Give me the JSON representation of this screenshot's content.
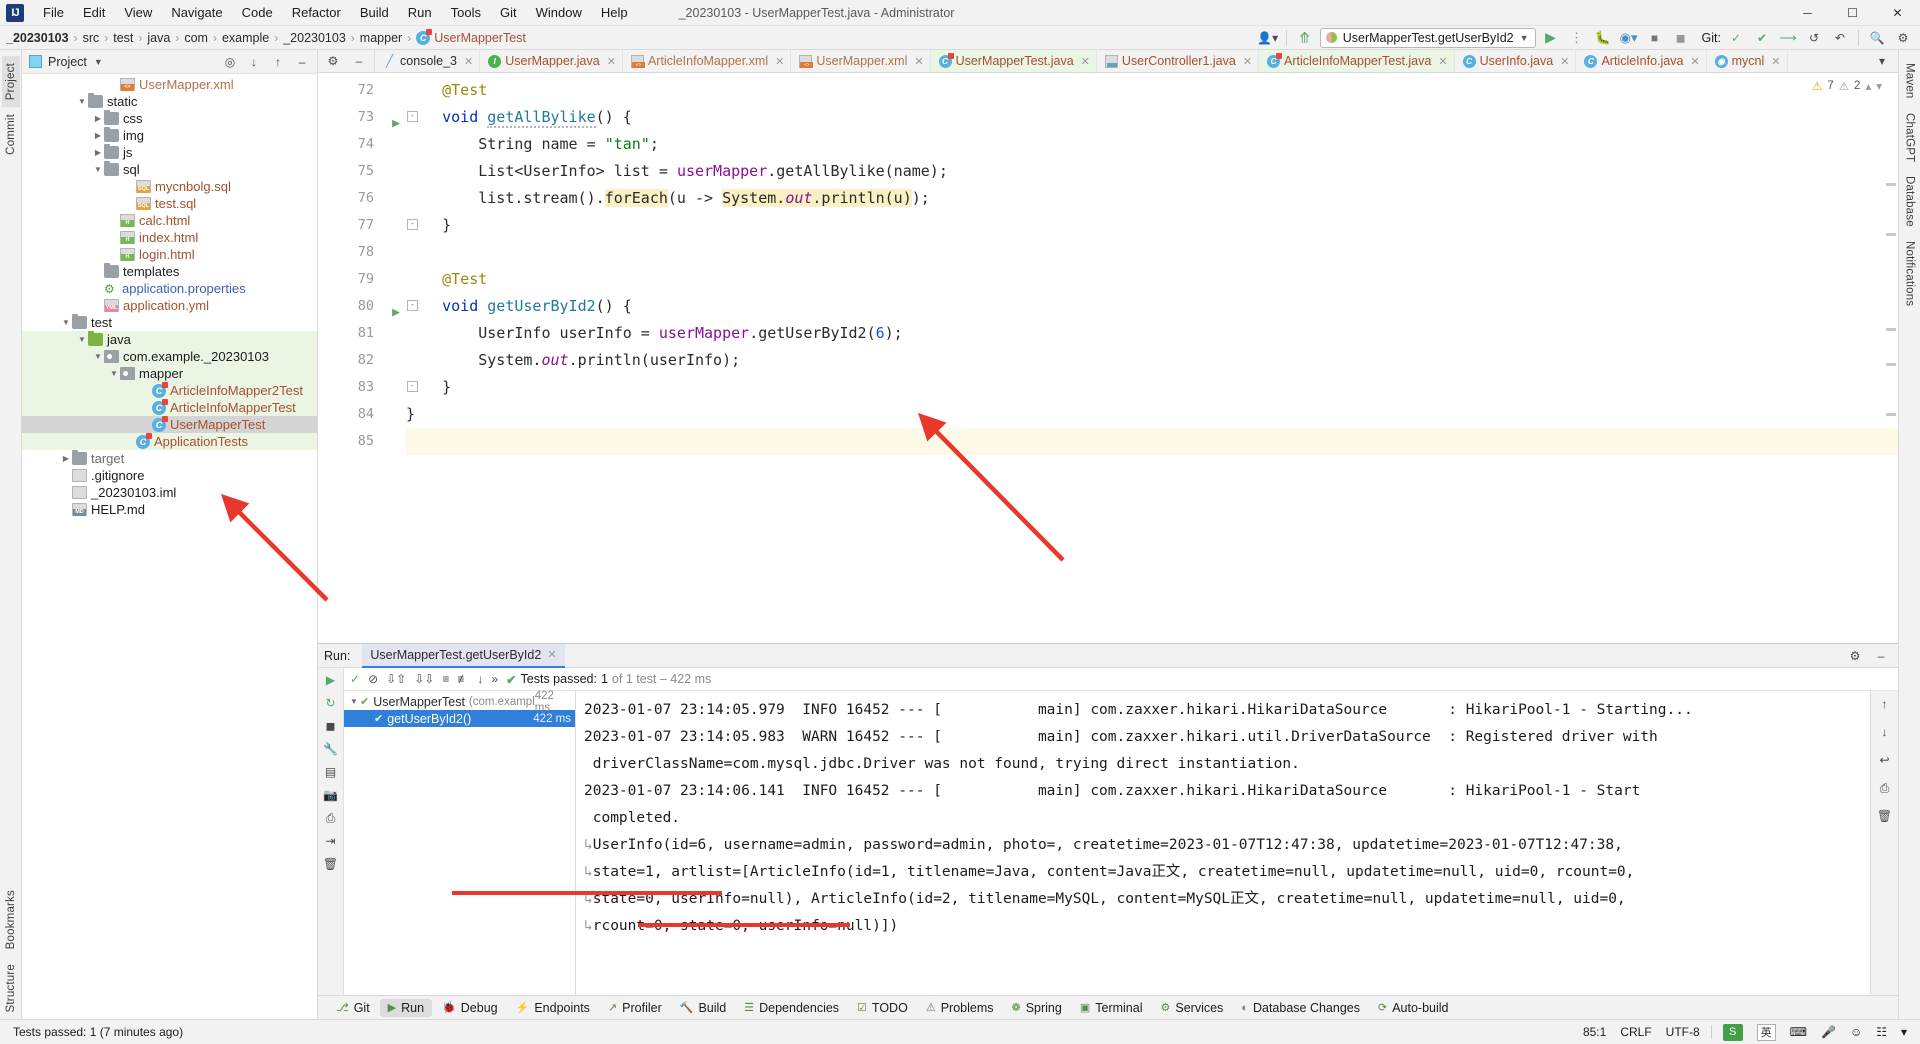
{
  "window": {
    "title": "_20230103 - UserMapperTest.java - Administrator",
    "logo": "IJ",
    "minimize": "─",
    "maximize": "☐",
    "close": "✕"
  },
  "menu": [
    "File",
    "Edit",
    "View",
    "Navigate",
    "Code",
    "Refactor",
    "Build",
    "Run",
    "Tools",
    "Git",
    "Window",
    "Help"
  ],
  "breadcrumb": {
    "items": [
      "_20230103",
      "src",
      "test",
      "java",
      "com",
      "example",
      "_20230103",
      "mapper",
      "UserMapperTest"
    ],
    "separator": "›"
  },
  "navbar_right": {
    "run_config": "UserMapperTest.getUserById2",
    "git_label": "Git:",
    "run_icon": "run-icon",
    "debug_icon": "debug-icon",
    "coverage_icon": "coverage-icon",
    "stop_icon": "stop-icon",
    "search_icon": "search-icon",
    "settings_icon": "settings-icon"
  },
  "left_strip": [
    {
      "label": "Project",
      "active": true
    },
    {
      "label": "Commit",
      "active": false
    }
  ],
  "right_strip": [
    {
      "label": "Maven"
    },
    {
      "label": "ChatGPT"
    },
    {
      "label": "Database"
    },
    {
      "label": "Notifications"
    }
  ],
  "bottom_strip": [
    {
      "label": "Bookmarks"
    },
    {
      "label": "Structure"
    }
  ],
  "project_panel": {
    "title": "Project",
    "tree": [
      {
        "indent": 5,
        "arrow": "",
        "icon": "xml-file",
        "label": "UserMapper.xml",
        "style": "xml",
        "bg": ""
      },
      {
        "indent": 3,
        "arrow": "v",
        "icon": "folder",
        "label": "static",
        "style": "plain",
        "bg": ""
      },
      {
        "indent": 4,
        "arrow": ">",
        "icon": "folder",
        "label": "css",
        "style": "plain",
        "bg": ""
      },
      {
        "indent": 4,
        "arrow": ">",
        "icon": "folder",
        "label": "img",
        "style": "plain",
        "bg": ""
      },
      {
        "indent": 4,
        "arrow": ">",
        "icon": "folder",
        "label": "js",
        "style": "plain",
        "bg": ""
      },
      {
        "indent": 4,
        "arrow": "v",
        "icon": "folder",
        "label": "sql",
        "style": "plain",
        "bg": ""
      },
      {
        "indent": 6,
        "arrow": "",
        "icon": "sql-file",
        "label": "mycnbolg.sql",
        "style": "sql",
        "bg": ""
      },
      {
        "indent": 6,
        "arrow": "",
        "icon": "sql-file",
        "label": "test.sql",
        "style": "sql",
        "bg": ""
      },
      {
        "indent": 5,
        "arrow": "",
        "icon": "html-file",
        "label": "calc.html",
        "style": "html",
        "bg": ""
      },
      {
        "indent": 5,
        "arrow": "",
        "icon": "html-file",
        "label": "index.html",
        "style": "html",
        "bg": ""
      },
      {
        "indent": 5,
        "arrow": "",
        "icon": "html-file",
        "label": "login.html",
        "style": "html",
        "bg": ""
      },
      {
        "indent": 4,
        "arrow": "",
        "icon": "folder",
        "label": "templates",
        "style": "plain",
        "bg": ""
      },
      {
        "indent": 4,
        "arrow": "",
        "icon": "props",
        "label": "application.properties",
        "style": "props",
        "bg": ""
      },
      {
        "indent": 4,
        "arrow": "",
        "icon": "yml-file",
        "label": "application.yml",
        "style": "yml",
        "bg": ""
      },
      {
        "indent": 2,
        "arrow": "v",
        "icon": "folder",
        "label": "test",
        "style": "plain",
        "bg": ""
      },
      {
        "indent": 3,
        "arrow": "v",
        "icon": "src-folder",
        "label": "java",
        "style": "plain",
        "bg": "green"
      },
      {
        "indent": 4,
        "arrow": "v",
        "icon": "package",
        "label": "com.example._20230103",
        "style": "plain",
        "bg": "green"
      },
      {
        "indent": 5,
        "arrow": "v",
        "icon": "package",
        "label": "mapper",
        "style": "plain",
        "bg": "green"
      },
      {
        "indent": 7,
        "arrow": "",
        "icon": "test-class",
        "label": "ArticleInfoMapper2Test",
        "style": "cls",
        "bg": "green"
      },
      {
        "indent": 7,
        "arrow": "",
        "icon": "test-class",
        "label": "ArticleInfoMapperTest",
        "style": "cls",
        "bg": "green"
      },
      {
        "indent": 7,
        "arrow": "",
        "icon": "test-class",
        "label": "UserMapperTest",
        "style": "cls",
        "bg": "sel"
      },
      {
        "indent": 6,
        "arrow": "",
        "icon": "test-class",
        "label": "ApplicationTests",
        "style": "cls",
        "bg": "green"
      },
      {
        "indent": 2,
        "arrow": ">",
        "icon": "folder",
        "label": "target",
        "style": "dim",
        "bg": ""
      },
      {
        "indent": 2,
        "arrow": "",
        "icon": "doc-file",
        "label": ".gitignore",
        "style": "plain",
        "bg": ""
      },
      {
        "indent": 2,
        "arrow": "",
        "icon": "doc-file",
        "label": "_20230103.iml",
        "style": "plain",
        "bg": ""
      },
      {
        "indent": 2,
        "arrow": "",
        "icon": "md-file",
        "label": "HELP.md",
        "style": "plain",
        "bg": ""
      }
    ]
  },
  "editor": {
    "tabs": [
      {
        "label": "console_3",
        "icon": "console-icon",
        "style": "plain",
        "active": false
      },
      {
        "label": "UserMapper.java",
        "icon": "interface-icon",
        "style": "cls",
        "active": false
      },
      {
        "label": "ArticleInfoMapper.xml",
        "icon": "xml-icon",
        "style": "xml",
        "active": false
      },
      {
        "label": "UserMapper.xml",
        "icon": "xml-icon",
        "style": "xml",
        "active": false
      },
      {
        "label": "UserMapperTest.java",
        "icon": "test-icon",
        "style": "cls",
        "active": true
      },
      {
        "label": "UserController1.java",
        "icon": "spring-icon",
        "style": "cls",
        "active": false
      },
      {
        "label": "ArticleInfoMapperTest.java",
        "icon": "test-icon",
        "style": "cls",
        "active": true
      },
      {
        "label": "UserInfo.java",
        "icon": "class-icon",
        "style": "cls",
        "active": false
      },
      {
        "label": "ArticleInfo.java",
        "icon": "class-icon",
        "style": "cls",
        "active": false
      },
      {
        "label": "mycnl",
        "icon": "db-icon",
        "style": "cls",
        "active": false
      }
    ],
    "inspections": {
      "warnings": "7",
      "weak": "2"
    },
    "lines": [
      {
        "num": "72",
        "run": false,
        "fold": "",
        "current": false,
        "html": "    <span class=\"ann\">@Test</span>"
      },
      {
        "num": "73",
        "run": true,
        "fold": "-",
        "current": false,
        "html": "    <span class=\"kw\">void</span> <span class=\"mth squig\">getAllBylike</span>() {"
      },
      {
        "num": "74",
        "run": false,
        "fold": "",
        "current": false,
        "html": "        String name = <span class=\"str\">\"tan\"</span>;"
      },
      {
        "num": "75",
        "run": false,
        "fold": "",
        "current": false,
        "html": "        List&lt;UserInfo&gt; list = <span class=\"fld\">userMapper</span>.getAllBylike(name);"
      },
      {
        "num": "76",
        "run": false,
        "fold": "",
        "current": false,
        "html": "        list.stream().<span class=\"hl\">forEach</span>(u -&gt; <span class=\"hl\">System.<span class=\"sfld\">out</span>.println(u)</span>);"
      },
      {
        "num": "77",
        "run": false,
        "fold": "-",
        "current": false,
        "html": "    }"
      },
      {
        "num": "78",
        "run": false,
        "fold": "",
        "current": false,
        "html": ""
      },
      {
        "num": "79",
        "run": false,
        "fold": "",
        "current": false,
        "html": "    <span class=\"ann\">@Test</span>"
      },
      {
        "num": "80",
        "run": true,
        "fold": "-",
        "current": false,
        "html": "    <span class=\"kw\">void</span> <span class=\"mth\">getUserById2</span>() {"
      },
      {
        "num": "81",
        "run": false,
        "fold": "",
        "current": false,
        "html": "        UserInfo userInfo = <span class=\"fld\">userMapper</span>.getUserById2(<span class=\"num\">6</span>);"
      },
      {
        "num": "82",
        "run": false,
        "fold": "",
        "current": false,
        "html": "        System.<span class=\"sfld\">out</span>.println(userInfo);"
      },
      {
        "num": "83",
        "run": false,
        "fold": "-",
        "current": false,
        "html": "    }"
      },
      {
        "num": "84",
        "run": false,
        "fold": "",
        "current": false,
        "html": "}"
      },
      {
        "num": "85",
        "run": false,
        "fold": "",
        "current": true,
        "html": ""
      }
    ]
  },
  "run_panel": {
    "label": "Run:",
    "tab_title": "UserMapperTest.getUserById2",
    "status": {
      "prefix": "Tests passed:",
      "count": "1",
      "suffix": "of 1 test – 422 ms"
    },
    "test_tree": [
      {
        "indent": 0,
        "arrow": "v",
        "label": "UserMapperTest",
        "sub": "(com.exampl",
        "duration": "422 ms",
        "selected": false
      },
      {
        "indent": 1,
        "arrow": "",
        "label": "getUserById2()",
        "sub": "",
        "duration": "422 ms",
        "selected": true
      }
    ],
    "console": [
      {
        "text": "2023-01-07 23:14:05.979  INFO 16452 --- [           main] com.zaxxer.hikari.HikariDataSource       : HikariPool-1 - Starting...",
        "wrap": false
      },
      {
        "text": "2023-01-07 23:14:05.983  WARN 16452 --- [           main] com.zaxxer.hikari.util.DriverDataSource  : Registered driver with",
        "wrap": false
      },
      {
        "text": " driverClassName=com.mysql.jdbc.Driver was not found, trying direct instantiation.",
        "wrap": false
      },
      {
        "text": "2023-01-07 23:14:06.141  INFO 16452 --- [           main] com.zaxxer.hikari.HikariDataSource       : HikariPool-1 - Start",
        "wrap": false
      },
      {
        "text": " completed.",
        "wrap": false
      },
      {
        "text": "UserInfo(id=6, username=admin, password=admin, photo=, createtime=2023-01-07T12:47:38, updatetime=2023-01-07T12:47:38,",
        "wrap": true
      },
      {
        "text": "state=1, artlist=[ArticleInfo(id=1, titlename=Java, content=Java正文, createtime=null, updatetime=null, uid=0, rcount=0,",
        "wrap": true
      },
      {
        "text": "state=0, userInfo=null), ArticleInfo(id=2, titlename=MySQL, content=MySQL正文, createtime=null, updatetime=null, uid=0,",
        "wrap": true
      },
      {
        "text": "rcount=0, state=0, userInfo=null)])",
        "wrap": true
      }
    ]
  },
  "bottom_bar": [
    {
      "label": "Git",
      "icon": "git-icon",
      "active": false
    },
    {
      "label": "Run",
      "icon": "run-icon",
      "active": true
    },
    {
      "label": "Debug",
      "icon": "debug-icon",
      "active": false
    },
    {
      "label": "Endpoints",
      "icon": "endpoints-icon",
      "active": false
    },
    {
      "label": "Profiler",
      "icon": "profiler-icon",
      "active": false
    },
    {
      "label": "Build",
      "icon": "build-icon",
      "active": false
    },
    {
      "label": "Dependencies",
      "icon": "deps-icon",
      "active": false
    },
    {
      "label": "TODO",
      "icon": "todo-icon",
      "active": false
    },
    {
      "label": "Problems",
      "icon": "problems-icon",
      "active": false
    },
    {
      "label": "Spring",
      "icon": "spring-icon",
      "active": false
    },
    {
      "label": "Terminal",
      "icon": "terminal-icon",
      "active": false
    },
    {
      "label": "Services",
      "icon": "services-icon",
      "active": false
    },
    {
      "label": "Database Changes",
      "icon": "database-icon",
      "active": false
    },
    {
      "label": "Auto-build",
      "icon": "autobuild-icon",
      "active": false
    }
  ],
  "status_bar": {
    "message": "Tests passed: 1 (7 minutes ago)",
    "caret": "85:1",
    "line_sep": "CRLF",
    "encoding": "UTF-8",
    "ime_lang": "英",
    "ime_mark": "S"
  },
  "colors": {
    "accent_blue": "#3c7de0",
    "green_tab": "#eaf5e4",
    "selection": "#d4d4d4",
    "annotation": "#9e880d",
    "keyword": "#0033b3",
    "string": "#067d17",
    "arrow_red": "#e8372c"
  }
}
